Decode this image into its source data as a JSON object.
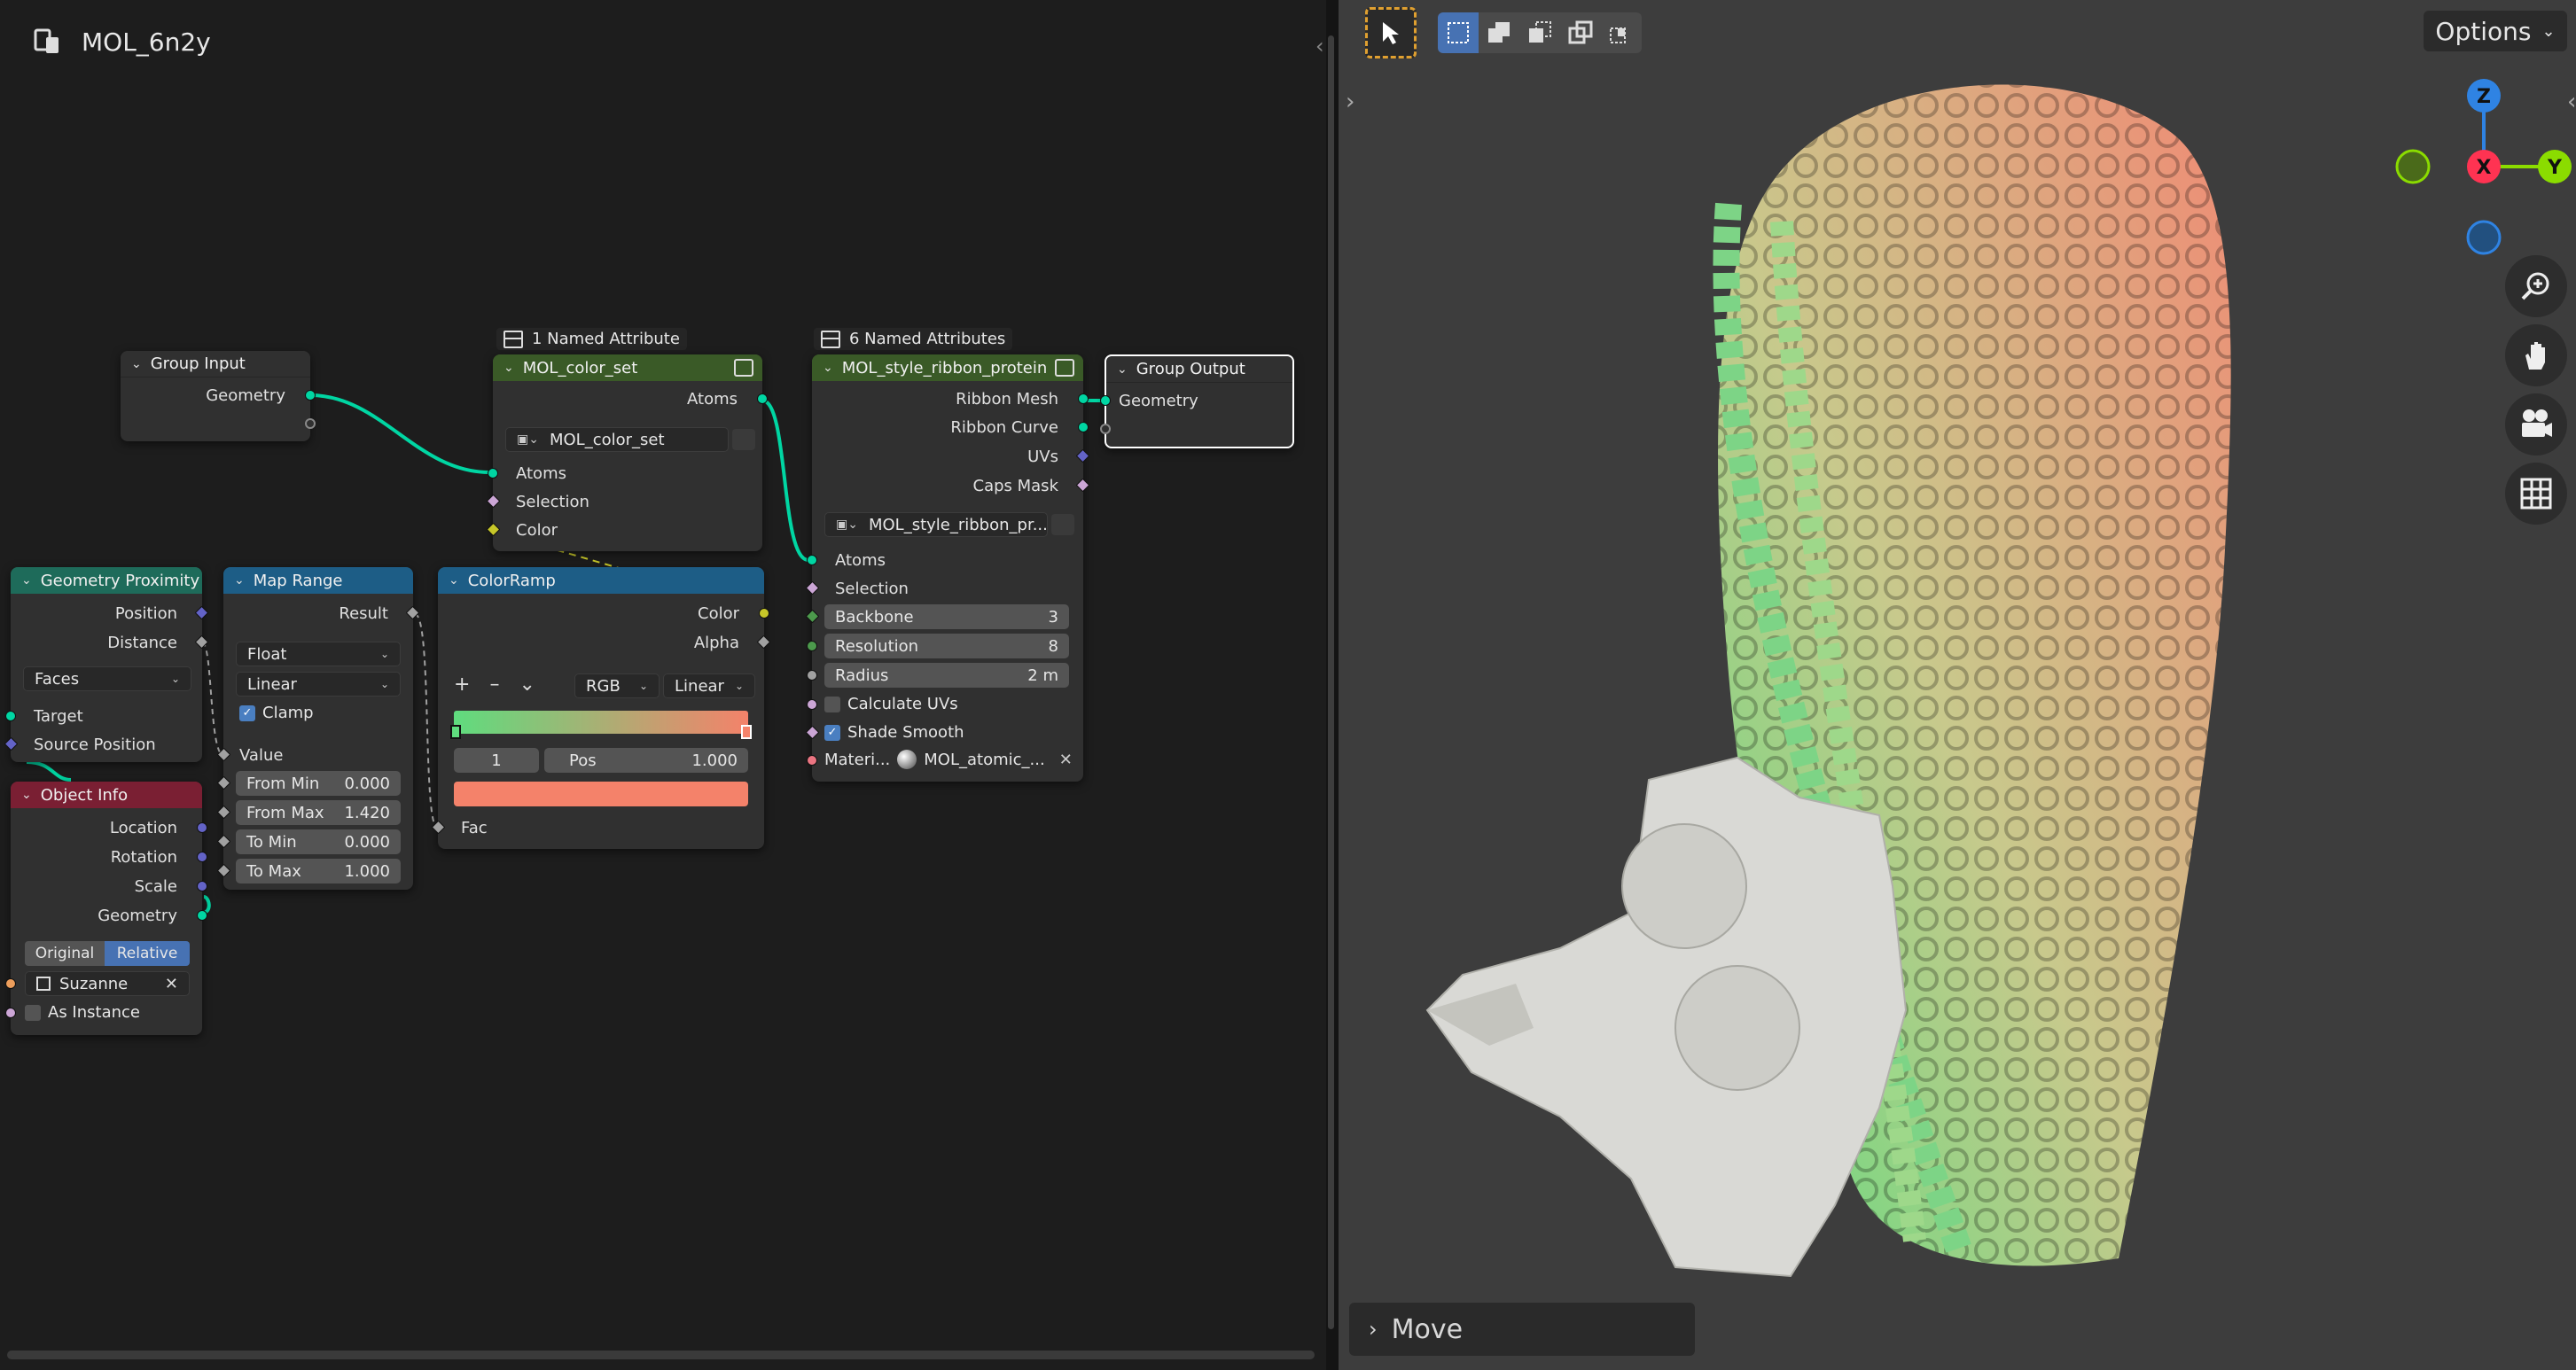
{
  "editor": {
    "tree_name": "MOL_6n2y",
    "frames": [
      {
        "label": "1 Named Attribute"
      },
      {
        "label": "6 Named Attributes"
      }
    ],
    "group_input": {
      "title": "Group Input",
      "outputs": [
        "Geometry"
      ]
    },
    "mol_color_set": {
      "title": "MOL_color_set",
      "outputs": [
        "Atoms"
      ],
      "selector_value": "MOL_color_set",
      "inputs": [
        "Atoms",
        "Selection",
        "Color"
      ]
    },
    "mol_style_ribbon": {
      "title": "MOL_style_ribbon_protein",
      "outputs": [
        "Ribbon Mesh",
        "Ribbon Curve",
        "UVs",
        "Caps Mask"
      ],
      "selector_value": "MOL_style_ribbon_pr...",
      "inputs": [
        "Atoms",
        "Selection"
      ],
      "fields": [
        {
          "label": "Backbone",
          "value": "3"
        },
        {
          "label": "Resolution",
          "value": "8"
        },
        {
          "label": "Radius",
          "value": "2 m"
        }
      ],
      "checks": [
        {
          "label": "Calculate UVs",
          "checked": false
        },
        {
          "label": "Shade Smooth",
          "checked": true
        }
      ],
      "material_label": "Materi...",
      "material_value": "MOL_atomic_..."
    },
    "group_output": {
      "title": "Group Output",
      "inputs": [
        "Geometry"
      ]
    },
    "geometry_proximity": {
      "title": "Geometry Proximity",
      "outputs": [
        "Position",
        "Distance"
      ],
      "mode": "Faces",
      "inputs": [
        "Target",
        "Source Position"
      ]
    },
    "map_range": {
      "title": "Map Range",
      "outputs": [
        "Result"
      ],
      "data_type": "Float",
      "interpolation": "Linear",
      "clamp_label": "Clamp",
      "clamp": true,
      "value_label": "Value",
      "fields": [
        {
          "label": "From Min",
          "value": "0.000"
        },
        {
          "label": "From Max",
          "value": "1.420"
        },
        {
          "label": "To Min",
          "value": "0.000"
        },
        {
          "label": "To Max",
          "value": "1.000"
        }
      ]
    },
    "color_ramp": {
      "title": "ColorRamp",
      "outputs": [
        "Color",
        "Alpha"
      ],
      "add": "+",
      "remove": "–",
      "menu": "⌄",
      "color_mode": "RGB",
      "interpolation": "Linear",
      "stop_index": "1",
      "pos_label": "Pos",
      "pos_value": "1.000",
      "stop_color": "#f4826a",
      "gradient_start": "#5fdc7e",
      "gradient_end": "#f4826a",
      "input": "Fac"
    },
    "object_info": {
      "title": "Object Info",
      "outputs": [
        "Location",
        "Rotation",
        "Scale",
        "Geometry"
      ],
      "space_options": [
        "Original",
        "Relative"
      ],
      "space_selected": "Relative",
      "object": "Suzanne",
      "as_instance_label": "As Instance"
    }
  },
  "viewport": {
    "options_label": "Options",
    "gizmo_axes": [
      "Z",
      "X",
      "Y"
    ],
    "operator_panel": "Move",
    "colors": {
      "x": "#ff3352",
      "y": "#8bdc00",
      "z": "#2f83e3"
    }
  },
  "colors": {
    "geometry_socket": "#00d6a3",
    "vector_socket": "#6363c7",
    "float_socket": "#a1a1a1",
    "color_socket": "#c7c729",
    "bool_socket": "#cca6d6",
    "object_socket": "#ed9e5c",
    "material_socket": "#eb7582",
    "input_header": "#7a1f33",
    "group_header": "#3a5a27",
    "util_header": "#1d5d86",
    "geo_header": "#1e6b5a"
  }
}
